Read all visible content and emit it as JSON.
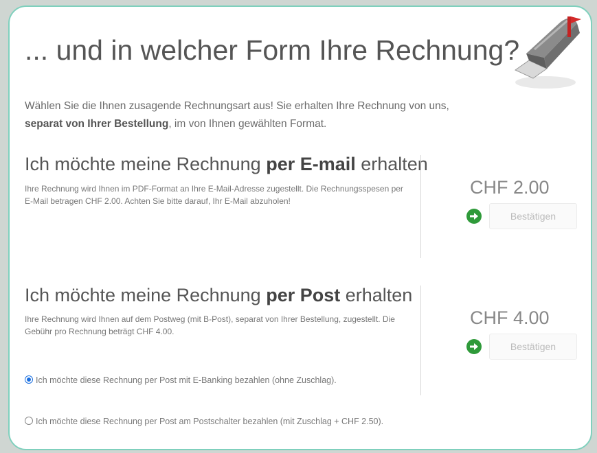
{
  "heading": "... und in welcher Form Ihre Rechnung?",
  "intro": {
    "line1": "Wählen Sie die Ihnen zusagende Rechnungsart aus! Sie erhalten Ihre Rechnung von uns,",
    "bold": "separat von Ihrer Bestellung",
    "line2_rest": ", im von Ihnen gewählten Format."
  },
  "email_option": {
    "title_pre": "Ich möchte meine Rechnung ",
    "title_bold": "per E-mail",
    "title_post": " erhalten",
    "description": "Ihre Rechnung wird Ihnen im PDF-Format an Ihre E-Mail-Adresse zugestellt. Die Rechnungsspesen per E-Mail betragen CHF 2.00. Achten Sie bitte darauf, Ihr E-Mail abzuholen!",
    "price": "CHF 2.00",
    "button_label": "Bestätigen"
  },
  "post_option": {
    "title_pre": "Ich möchte meine Rechnung ",
    "title_bold": "per Post",
    "title_post": " erhalten",
    "description": "Ihre Rechnung wird Ihnen auf dem Postweg (mit B-Post), separat von Ihrer Bestellung, zugestellt. Die Gebühr pro Rechnung beträgt CHF 4.00.",
    "price": "CHF 4.00",
    "button_label": "Bestätigen",
    "radio_options": [
      {
        "label": "Ich möchte diese Rechnung per Post mit E-Banking bezahlen (ohne Zuschlag).",
        "selected": true
      },
      {
        "label": "Ich möchte diese Rechnung per Post am Postschalter bezahlen (mit Zuschlag + CHF 2.50).",
        "selected": false
      }
    ]
  },
  "colors": {
    "panel_border": "#7fd0bd",
    "confirm_icon": "#2f9a3a",
    "radio_selected": "#1a6fe0"
  },
  "icons": {
    "header": "mailbox-icon",
    "confirm": "go-arrow-icon"
  }
}
